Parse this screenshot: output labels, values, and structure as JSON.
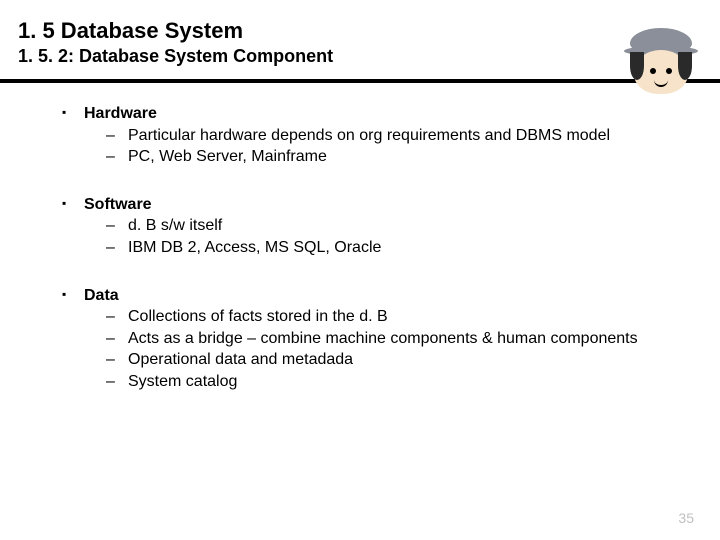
{
  "header": {
    "title": "1. 5 Database System",
    "subtitle": "1. 5. 2: Database System Component"
  },
  "sections": [
    {
      "heading": "Hardware",
      "items": [
        "Particular hardware depends on org requirements and DBMS model",
        "PC, Web Server, Mainframe"
      ]
    },
    {
      "heading": "Software",
      "items": [
        "d. B s/w itself",
        "IBM DB 2, Access, MS SQL, Oracle"
      ]
    },
    {
      "heading": "Data",
      "items": [
        "Collections of facts stored in the d. B",
        "Acts as a bridge – combine machine components & human components",
        "Operational data and metadada",
        "System catalog"
      ]
    }
  ],
  "page_number": "35"
}
